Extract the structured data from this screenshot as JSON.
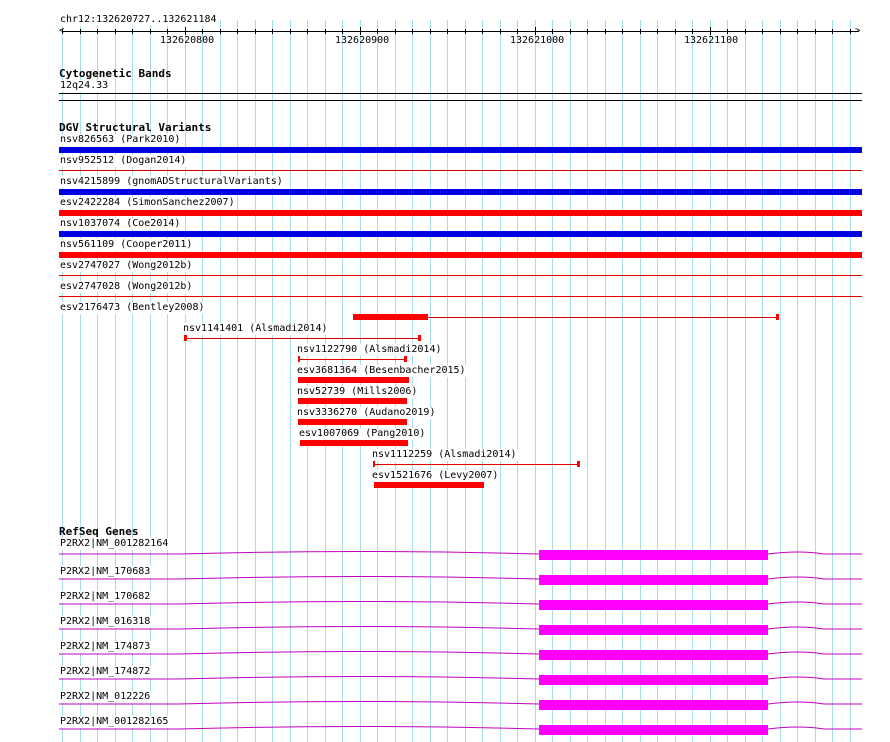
{
  "ruler": {
    "location_label": "chr12:132620727..132621184",
    "tick_labels": [
      "132620800",
      "132620900",
      "132621000",
      "132621100"
    ]
  },
  "cytogenetic": {
    "title": "Cytogenetic Bands",
    "band": "12q24.33"
  },
  "dgv": {
    "title": "DGV Structural Variants",
    "full_span_variants": [
      {
        "label": "nsv826563 (Park2010)",
        "color": "#0000e0",
        "style": "thick"
      },
      {
        "label": "nsv952512 (Dogan2014)",
        "color": "#e00000",
        "style": "thin"
      },
      {
        "label": "nsv4215899 (gnomADStructuralVariants)",
        "color": "#0000e0",
        "style": "thick"
      },
      {
        "label": "esv2422284 (SimonSanchez2007)",
        "color": "#ff0000",
        "style": "thick"
      },
      {
        "label": "nsv1037074 (Coe2014)",
        "color": "#0000e0",
        "style": "thick"
      },
      {
        "label": "nsv561109 (Cooper2011)",
        "color": "#ff0000",
        "style": "thick"
      },
      {
        "label": "esv2747027 (Wong2012b)",
        "color": "#e00000",
        "style": "thin"
      },
      {
        "label": "esv2747028 (Wong2012b)",
        "color": "#e00000",
        "style": "thin"
      }
    ],
    "partial_variants": [
      {
        "label": "esv2176473 (Bentley2008)"
      },
      {
        "label": "nsv1141401 (Alsmadi2014)"
      },
      {
        "label": "nsv1122790 (Alsmadi2014)"
      },
      {
        "label": "esv3681364 (Besenbacher2015)"
      },
      {
        "label": "nsv52739 (Mills2006)"
      },
      {
        "label": "nsv3336270 (Audano2019)"
      },
      {
        "label": "esv1007069 (Pang2010)"
      },
      {
        "label": "nsv1112259 (Alsmadi2014)"
      },
      {
        "label": "esv1521676 (Levy2007)"
      }
    ]
  },
  "refseq": {
    "title": "RefSeq Genes",
    "transcripts": [
      "P2RX2|NM_001282164",
      "P2RX2|NM_170683",
      "P2RX2|NM_170682",
      "P2RX2|NM_016318",
      "P2RX2|NM_174873",
      "P2RX2|NM_174872",
      "P2RX2|NM_012226",
      "P2RX2|NM_001282165"
    ],
    "gene_color": "#ff00ff",
    "intron_color": "#c000c0"
  },
  "colors": {
    "grid": "#a8dcec",
    "gain": "#0000e0",
    "loss": "#ff0000"
  }
}
